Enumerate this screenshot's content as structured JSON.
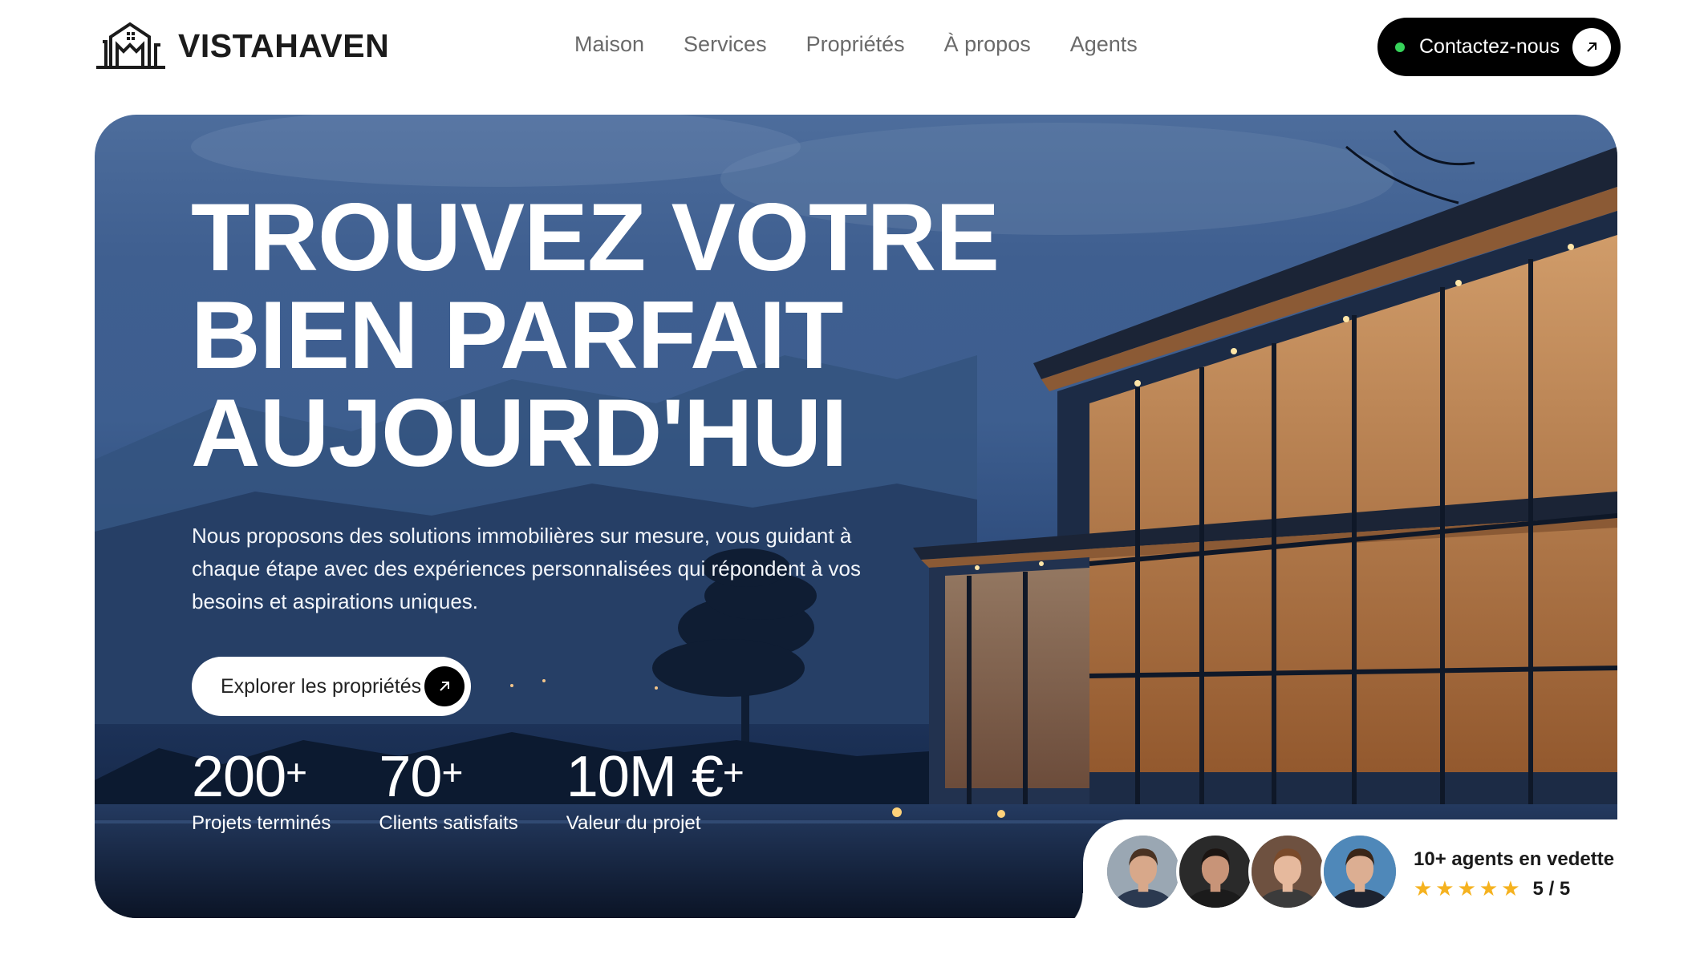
{
  "header": {
    "brand": "VISTAHAVEN",
    "nav": [
      {
        "label": "Maison"
      },
      {
        "label": "Services"
      },
      {
        "label": "Propriétés"
      },
      {
        "label": "À propos"
      },
      {
        "label": "Agents"
      }
    ],
    "contact_label": "Contactez-nous",
    "contact_status_color": "#36d35a"
  },
  "hero": {
    "title_lines": [
      "TROUVEZ VOTRE",
      "BIEN PARFAIT",
      "AUJOURD'HUI"
    ],
    "description": "Nous proposons des solutions immobilières sur mesure, vous guidant à chaque étape avec des expériences personnalisées qui répondent à vos besoins et aspirations uniques.",
    "cta_label": "Explorer les propriétés",
    "stats": [
      {
        "value": "200",
        "suffix": "+",
        "label": "Projets terminés"
      },
      {
        "value": "70",
        "suffix": "+",
        "label": "Clients satisfaits"
      },
      {
        "value": "10M €",
        "suffix": "+",
        "label": "Valeur du projet"
      }
    ]
  },
  "agents": {
    "title": "10+ agents en vedette",
    "stars": "★★★★★",
    "star_color": "#f5b21f",
    "rating": "5 / 5",
    "avatars": [
      {
        "name": "agent-avatar-1",
        "skin": "#d8a88a",
        "hair": "#4a3222",
        "shirt": "#2b3950",
        "bg": "#9aa7b3"
      },
      {
        "name": "agent-avatar-2",
        "skin": "#c89478",
        "hair": "#1c1512",
        "shirt": "#1b1b1b",
        "bg": "#2a2a2a"
      },
      {
        "name": "agent-avatar-3",
        "skin": "#e6b99d",
        "hair": "#7a4a2a",
        "shirt": "#3b3b3b",
        "bg": "#6e5140"
      },
      {
        "name": "agent-avatar-4",
        "skin": "#dcae92",
        "hair": "#3a2618",
        "shirt": "#1d2330",
        "bg": "#4f88b9"
      }
    ]
  }
}
